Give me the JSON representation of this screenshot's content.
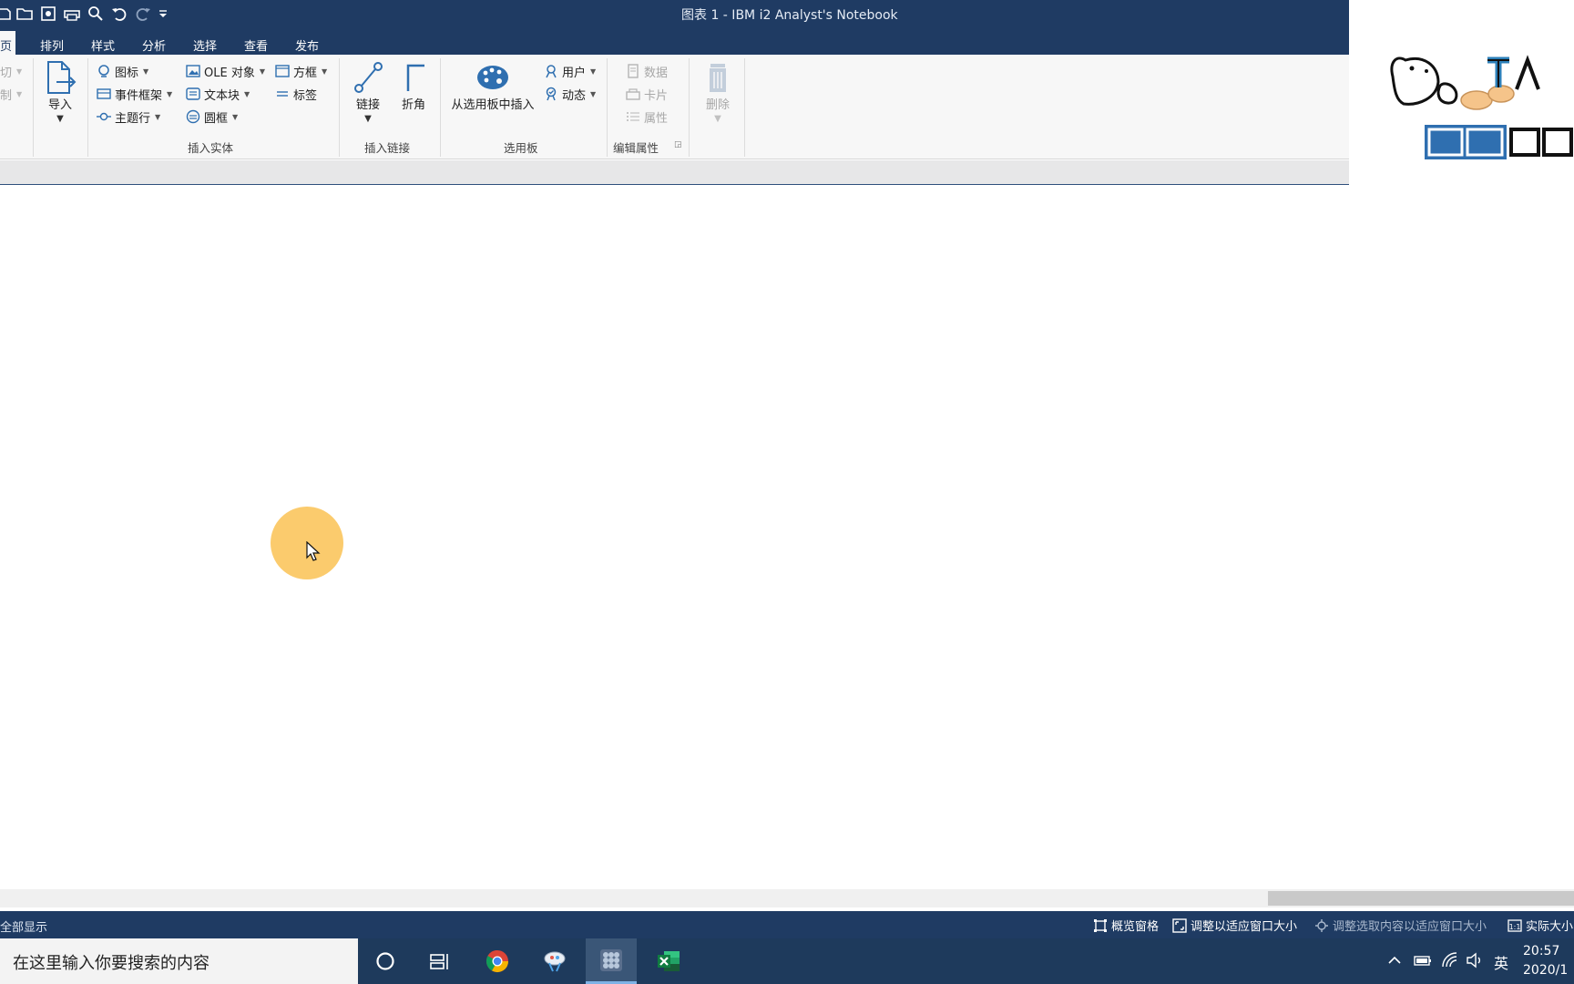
{
  "window": {
    "title": "图表 1 - IBM i2 Analyst's Notebook"
  },
  "tabs": [
    "页",
    "排列",
    "样式",
    "分析",
    "选择",
    "查看",
    "发布"
  ],
  "ribbon": {
    "clipboard": {
      "cut": "切",
      "copy": "制"
    },
    "import": {
      "label": "导入"
    },
    "insert_entity": {
      "group_label": "插入实体",
      "icon": "图标",
      "event_frame": "事件框架",
      "theme_line": "主题行",
      "ole_object": "OLE 对象",
      "text_block": "文本块",
      "circle_frame": "圆框",
      "box_frame": "方框",
      "label": "标签"
    },
    "insert_link": {
      "group_label": "插入链接",
      "link": "链接",
      "corner": "折角"
    },
    "palette": {
      "group_label": "选用板",
      "insert_from_palette": "从选用板中插入",
      "user": "用户",
      "dynamic": "动态"
    },
    "edit_properties": {
      "group_label": "编辑属性",
      "data": "数据",
      "card": "卡片",
      "attributes": "属性"
    },
    "delete": {
      "label": "删除"
    }
  },
  "status": {
    "left": "全部显示",
    "overview": "概览窗格",
    "fit_window": "调整以适应窗口大小",
    "fit_selection": "调整选取内容以适应窗口大小",
    "actual_size": "实际大小"
  },
  "taskbar": {
    "search_placeholder": "在这里输入你要搜索的内容",
    "ime": "英",
    "time": "20:57",
    "date": "2020/1"
  },
  "colors": {
    "title_bar": "#1f3b63",
    "ribbon_bg": "#f7f7f7",
    "taskbar": "#1e3a5c",
    "cursor_highlight": "#fbc865"
  },
  "icons": [
    "save-icon",
    "open-icon",
    "snapshot-icon",
    "print-icon",
    "zoom-icon",
    "undo-icon",
    "redo-icon",
    "customize-icon",
    "import-icon",
    "link-icon",
    "corner-icon",
    "palette-icon",
    "delete-icon",
    "overview-icon",
    "fit-window-icon",
    "fit-selection-icon",
    "actual-size-icon",
    "cortana-icon",
    "task-view-icon",
    "chrome-icon",
    "notebook-icon",
    "excel-icon"
  ]
}
